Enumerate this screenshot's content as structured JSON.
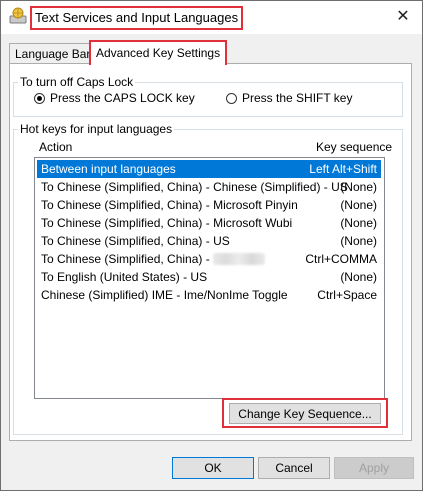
{
  "window": {
    "title": "Text Services and Input Languages",
    "close_glyph": "✕"
  },
  "tabs": [
    {
      "label": "Language Bar",
      "active": false
    },
    {
      "label": "Advanced Key Settings",
      "active": true
    }
  ],
  "caps_lock": {
    "legend": "To turn off Caps Lock",
    "options": [
      {
        "label": "Press the CAPS LOCK key",
        "selected": true
      },
      {
        "label": "Press the SHIFT key",
        "selected": false
      }
    ]
  },
  "hotkeys": {
    "legend": "Hot keys for input languages",
    "col_action": "Action",
    "col_key": "Key sequence",
    "rows": [
      {
        "action": "Between input languages",
        "key": "Left Alt+Shift",
        "selected": true
      },
      {
        "action": "To Chinese (Simplified, China) - Chinese (Simplified) - US",
        "key": "(None)"
      },
      {
        "action": "To Chinese (Simplified, China) - Microsoft Pinyin",
        "key": "(None)"
      },
      {
        "action": "To Chinese (Simplified, China) - Microsoft Wubi",
        "key": "(None)"
      },
      {
        "action": "To Chinese (Simplified, China) - US",
        "key": "(None)"
      },
      {
        "action": "To Chinese (Simplified, China) -",
        "key": "Ctrl+COMMA"
      },
      {
        "action": "To English (United States) - US",
        "key": "(None)"
      },
      {
        "action": "Chinese (Simplified) IME - Ime/NonIme Toggle",
        "key": "Ctrl+Space"
      }
    ],
    "change_button": "Change Key Sequence..."
  },
  "footer": {
    "ok": "OK",
    "cancel": "Cancel",
    "apply": "Apply"
  },
  "colors": {
    "highlight": "#e0303a",
    "selection": "#0078d7"
  }
}
